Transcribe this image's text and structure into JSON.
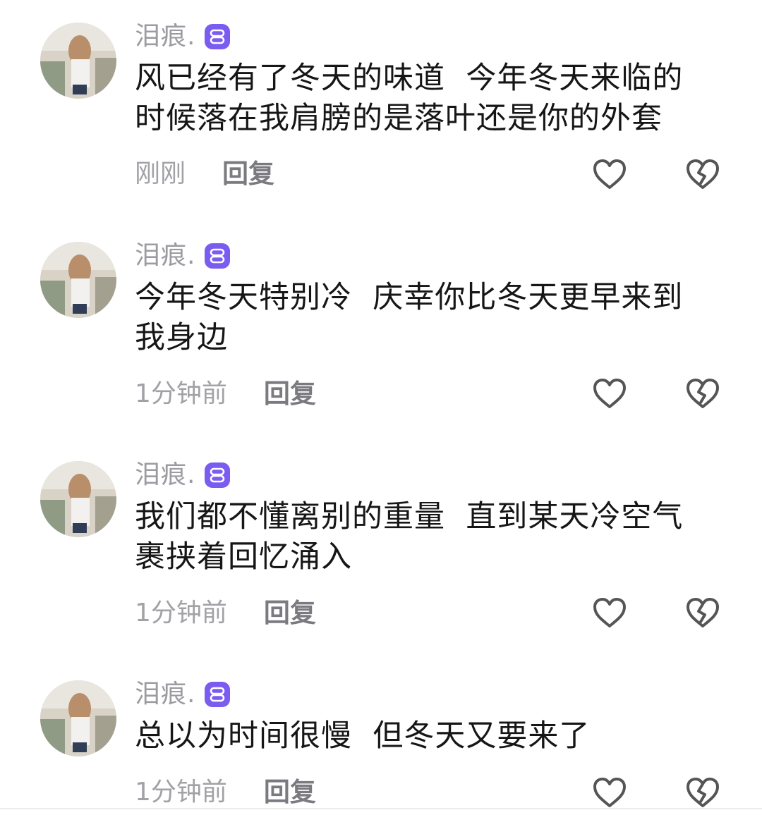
{
  "comments": [
    {
      "username": "泪痕.",
      "text": "风已经有了冬天的味道  今年冬天来临的时候落在我肩膀的是落叶还是你的外套",
      "time": "刚刚",
      "reply_label": "回复"
    },
    {
      "username": "泪痕.",
      "text": "今年冬天特别冷  庆幸你比冬天更早来到我身边",
      "time": "1分钟前",
      "reply_label": "回复"
    },
    {
      "username": "泪痕.",
      "text": "我们都不懂离别的重量  直到某天冷空气裹挟着回忆涌入",
      "time": "1分钟前",
      "reply_label": "回复"
    },
    {
      "username": "泪痕.",
      "text": "总以为时间很慢  但冬天又要来了",
      "time": "1分钟前",
      "reply_label": "回复"
    }
  ],
  "icons": {
    "badge": "purple-member-badge-icon",
    "like": "heart-outline-icon",
    "dislike": "broken-heart-icon"
  },
  "colors": {
    "badge": "#7b5cf0",
    "username": "#9b9ba1",
    "time": "#a1a1a6",
    "reply": "#7a7a80",
    "text": "#161616",
    "icon": "#555555"
  }
}
